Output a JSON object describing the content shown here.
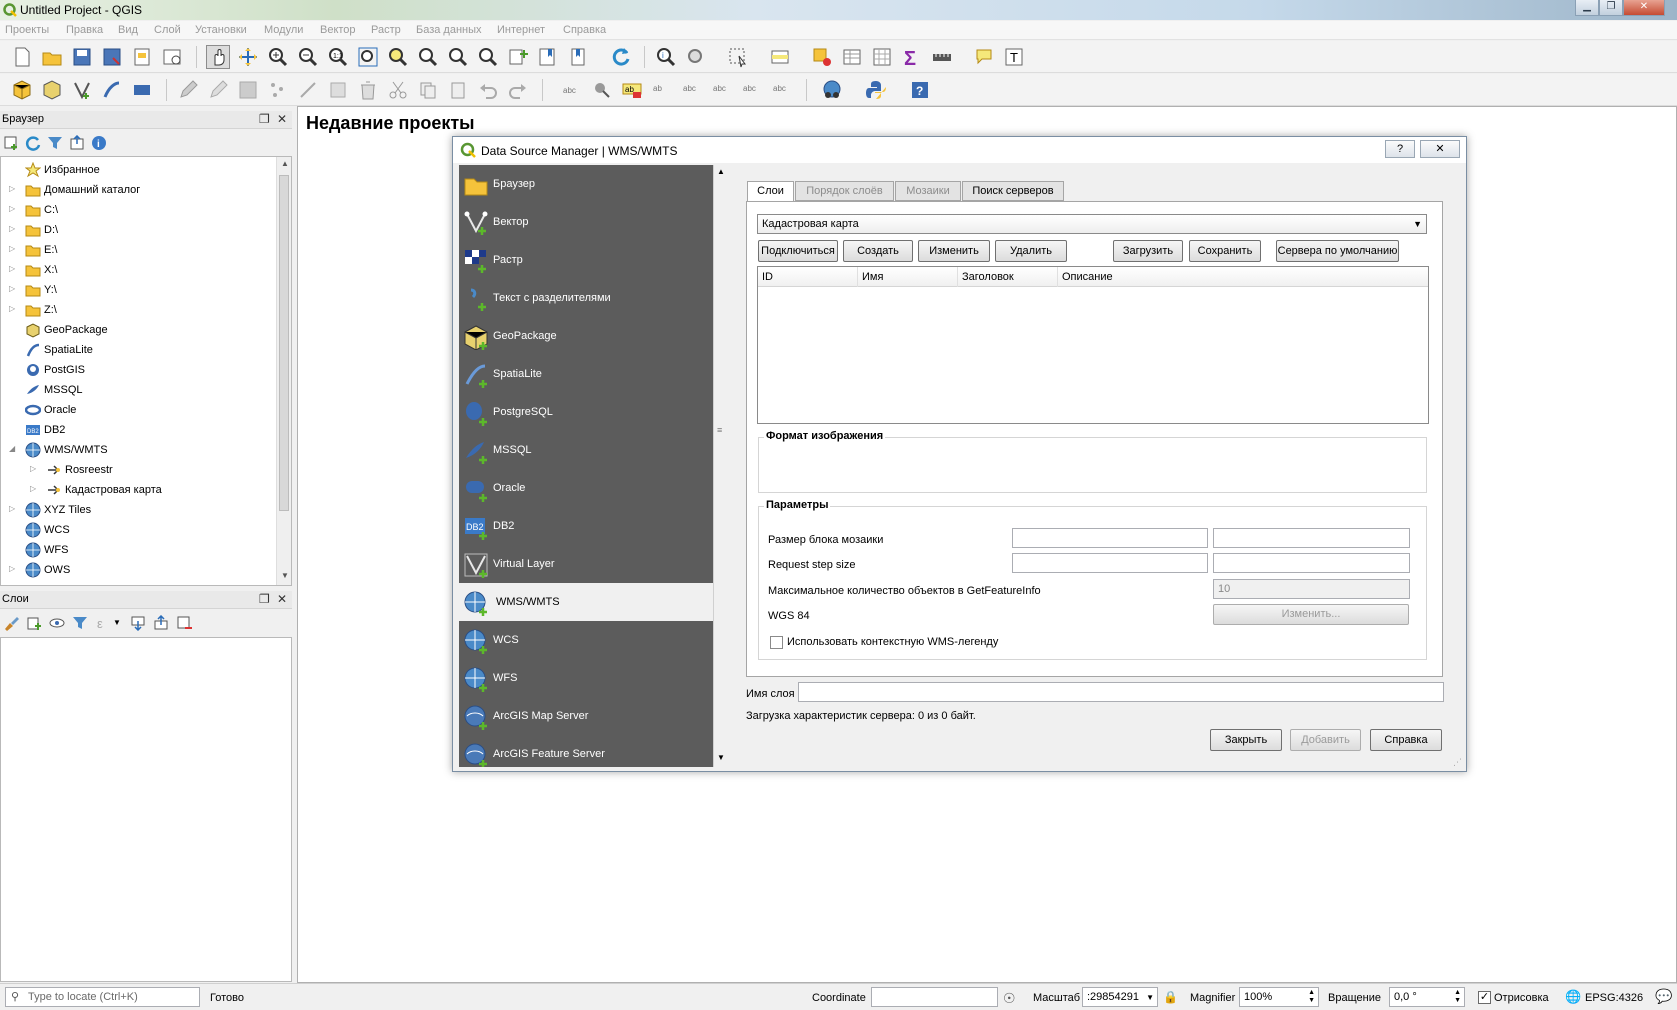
{
  "window": {
    "title": "Untitled Project - QGIS"
  },
  "menu": [
    "Проекты",
    "Правка",
    "Вид",
    "Слой",
    "Установки",
    "Модули",
    "Вектор",
    "Растр",
    "База данных",
    "Интернет",
    "Справка"
  ],
  "browser_panel": {
    "title": "Браузер",
    "items": [
      {
        "label": "Избранное",
        "icon": "star-icon"
      },
      {
        "label": "Домашний каталог",
        "icon": "folder-icon"
      },
      {
        "label": "C:\\",
        "icon": "folder-icon"
      },
      {
        "label": "D:\\",
        "icon": "folder-icon"
      },
      {
        "label": "E:\\",
        "icon": "folder-icon"
      },
      {
        "label": "X:\\",
        "icon": "folder-icon"
      },
      {
        "label": "Y:\\",
        "icon": "folder-icon"
      },
      {
        "label": "Z:\\",
        "icon": "folder-icon"
      },
      {
        "label": "GeoPackage",
        "icon": "geopackage-icon"
      },
      {
        "label": "SpatiaLite",
        "icon": "spatialite-icon"
      },
      {
        "label": "PostGIS",
        "icon": "postgis-icon"
      },
      {
        "label": "MSSQL",
        "icon": "mssql-icon"
      },
      {
        "label": "Oracle",
        "icon": "oracle-icon"
      },
      {
        "label": "DB2",
        "icon": "db2-icon"
      },
      {
        "label": "WMS/WMTS",
        "icon": "globe-icon"
      },
      {
        "label": "Rosreestr",
        "icon": "wms-connection-icon"
      },
      {
        "label": "Кадастровая карта",
        "icon": "wms-connection-icon"
      },
      {
        "label": "XYZ Tiles",
        "icon": "globe-icon"
      },
      {
        "label": "WCS",
        "icon": "globe-icon"
      },
      {
        "label": "WFS",
        "icon": "globe-icon"
      },
      {
        "label": "OWS",
        "icon": "globe-icon"
      }
    ]
  },
  "layers_panel": {
    "title": "Слои"
  },
  "main": {
    "recent_title": "Недавние проекты"
  },
  "dialog": {
    "title": "Data Source Manager | WMS/WMTS",
    "help_btn": "?",
    "close_btn": "✕",
    "sidebar": [
      {
        "label": "Браузер",
        "icon": "folder-icon"
      },
      {
        "label": "Вектор",
        "icon": "vector-icon"
      },
      {
        "label": "Растр",
        "icon": "raster-icon"
      },
      {
        "label": "Текст с разделителями",
        "icon": "delimited-text-icon"
      },
      {
        "label": "GeoPackage",
        "icon": "geopackage-icon"
      },
      {
        "label": "SpatiaLite",
        "icon": "spatialite-icon"
      },
      {
        "label": "PostgreSQL",
        "icon": "postgis-icon"
      },
      {
        "label": "MSSQL",
        "icon": "mssql-icon"
      },
      {
        "label": "Oracle",
        "icon": "oracle-icon"
      },
      {
        "label": "DB2",
        "icon": "db2-icon"
      },
      {
        "label": "Virtual Layer",
        "icon": "virtual-layer-icon"
      },
      {
        "label": "WMS/WMTS",
        "icon": "globe-icon"
      },
      {
        "label": "WCS",
        "icon": "globe-icon"
      },
      {
        "label": "WFS",
        "icon": "globe-icon"
      },
      {
        "label": "ArcGIS Map Server",
        "icon": "arcgis-icon"
      },
      {
        "label": "ArcGIS Feature Server",
        "icon": "arcgis-icon"
      }
    ],
    "tabs": [
      "Слои",
      "Порядок слоёв",
      "Мозаики",
      "Поиск серверов"
    ],
    "connection_value": "Кадастровая карта",
    "buttons": {
      "connect": "Подключиться",
      "create": "Создать",
      "edit": "Изменить",
      "delete": "Удалить",
      "load": "Загрузить",
      "save": "Сохранить",
      "default_servers": "Сервера по умолчанию"
    },
    "table_headers": [
      "ID",
      "Имя",
      "Заголовок",
      "Описание"
    ],
    "image_format_title": "Формат изображения",
    "params_title": "Параметры",
    "params": {
      "tile_size": "Размер блока мозаики",
      "step_size": "Request step size",
      "max_features": "Максимальное количество объектов в GetFeatureInfo",
      "max_features_value": "10",
      "crs": "WGS 84",
      "crs_change": "Изменить...",
      "contextual_legend": "Использовать контекстную WMS-легенду"
    },
    "layer_name_label": "Имя слоя",
    "status": "Загрузка характеристик сервера: 0 из 0 байт.",
    "footer": {
      "close": "Закрыть",
      "add": "Добавить",
      "help": "Справка"
    }
  },
  "statusbar": {
    "locate_placeholder": "Type to locate (Ctrl+K)",
    "ready": "Готово",
    "coordinate_label": "Coordinate",
    "scale_label": "Масштаб",
    "scale_value": ":29854291",
    "magnifier_label": "Magnifier",
    "magnifier_value": "100%",
    "rotation_label": "Вращение",
    "rotation_value": "0,0 °",
    "render_label": "Отрисовка",
    "crs": "EPSG:4326"
  },
  "colors": {
    "dialog_sidebar": "#5c5c5c",
    "qgis_green": "#589632",
    "qgis_yellow": "#f0c000"
  }
}
